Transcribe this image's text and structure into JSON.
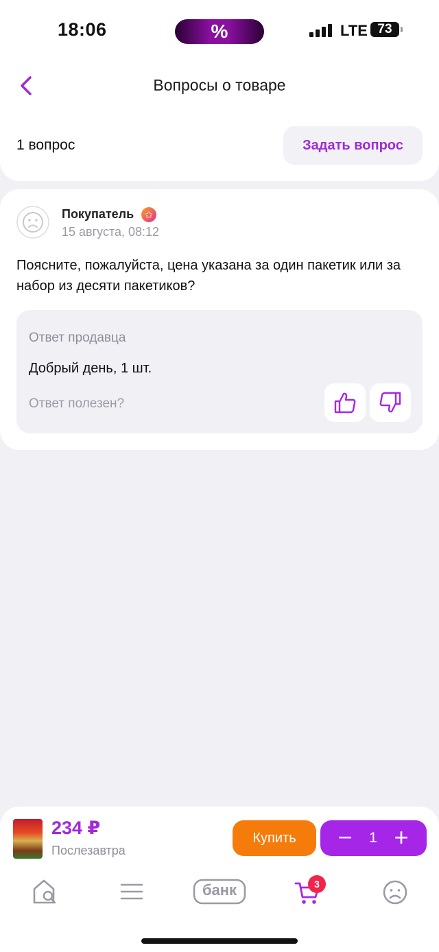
{
  "status_bar": {
    "time": "18:06",
    "promo_symbol": "%",
    "network": "LTE",
    "battery": "73"
  },
  "header": {
    "title": "Вопросы о товаре"
  },
  "questions_summary": {
    "count_label": "1 вопрос",
    "ask_button": "Задать вопрос"
  },
  "question": {
    "author": "Покупатель",
    "date": "15 августа, 08:12",
    "text": "Поясните, пожалуйста, цена указана за один пакетик или за набор из десяти пакетиков?",
    "answer": {
      "label": "Ответ продавца",
      "text": "Добрый день, 1 шт.",
      "helpful_prompt": "Ответ полезен?"
    }
  },
  "buy_bar": {
    "price": "234 ₽",
    "delivery": "Послезавтра",
    "buy_button": "Купить",
    "quantity": "1"
  },
  "tab_bar": {
    "bank_label": "банк",
    "cart_count": "3"
  },
  "colors": {
    "accent": "#a626e8",
    "buy": "#f57c0b",
    "badge": "#f1254b"
  }
}
